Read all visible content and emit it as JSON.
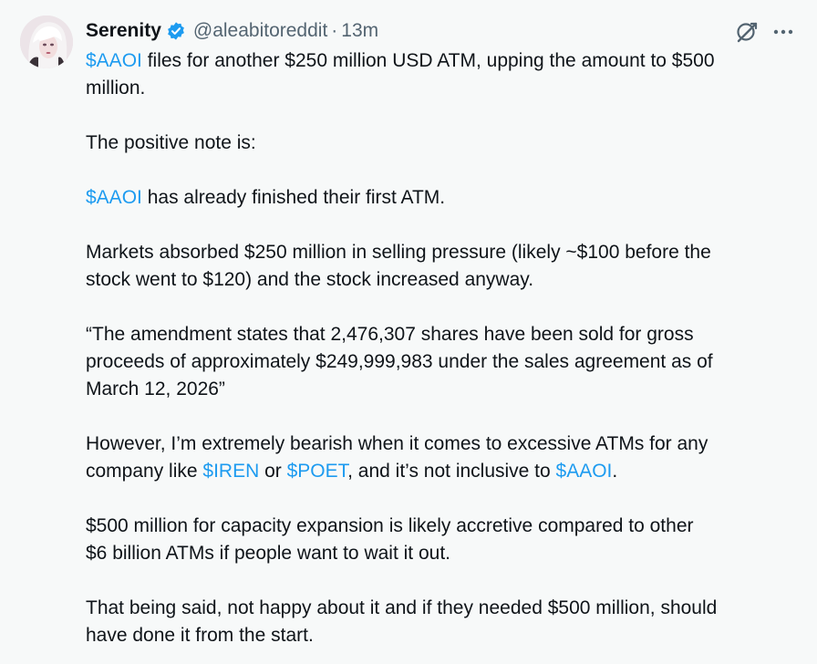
{
  "colors": {
    "background": "#f7f9f9",
    "text": "#0f1419",
    "muted": "#536471",
    "link": "#1d9bf0",
    "verified": "#1d9bf0"
  },
  "icons": {
    "verified": "verified-badge-icon",
    "grok": "grok-icon",
    "more": "more-icon"
  },
  "author": {
    "name": "Serenity",
    "handle": "@aleabitoreddit",
    "separator": "·",
    "time": "13m"
  },
  "tweet": {
    "p1": {
      "tag": "$AAOI",
      "line1": " files for another $250 million USD ATM, upping the amount to $500",
      "line2": "million."
    },
    "p2": "The positive note is:",
    "p3": {
      "tag": "$AAOI",
      "text": " has already finished their first ATM."
    },
    "p4": {
      "line1": "Markets absorbed $250 million in selling pressure (likely ~$100 before the",
      "line2": "stock went to $120) and the stock increased anyway."
    },
    "p5": {
      "line1": "“The amendment states that 2,476,307 shares have been sold for gross",
      "line2": "proceeds of approximately $249,999,983 under the sales agreement as of",
      "line3": "March 12, 2026”"
    },
    "p6": {
      "line1": "However, I’m extremely bearish when it comes to excessive ATMs for any",
      "line2_pre": "company like ",
      "tag1": "$IREN",
      "mid1": " or ",
      "tag2": "$POET",
      "mid2": ", and it’s not inclusive to ",
      "tag3": "$AAOI",
      "end": "."
    },
    "p7": {
      "line1": "$500 million for capacity expansion is likely accretive compared to other",
      "line2": "$6 billion ATMs if people want to wait it out."
    },
    "p8": {
      "line1": "That being said, not happy about it and if they needed $500 million, should",
      "line2": "have done it from the start."
    }
  }
}
